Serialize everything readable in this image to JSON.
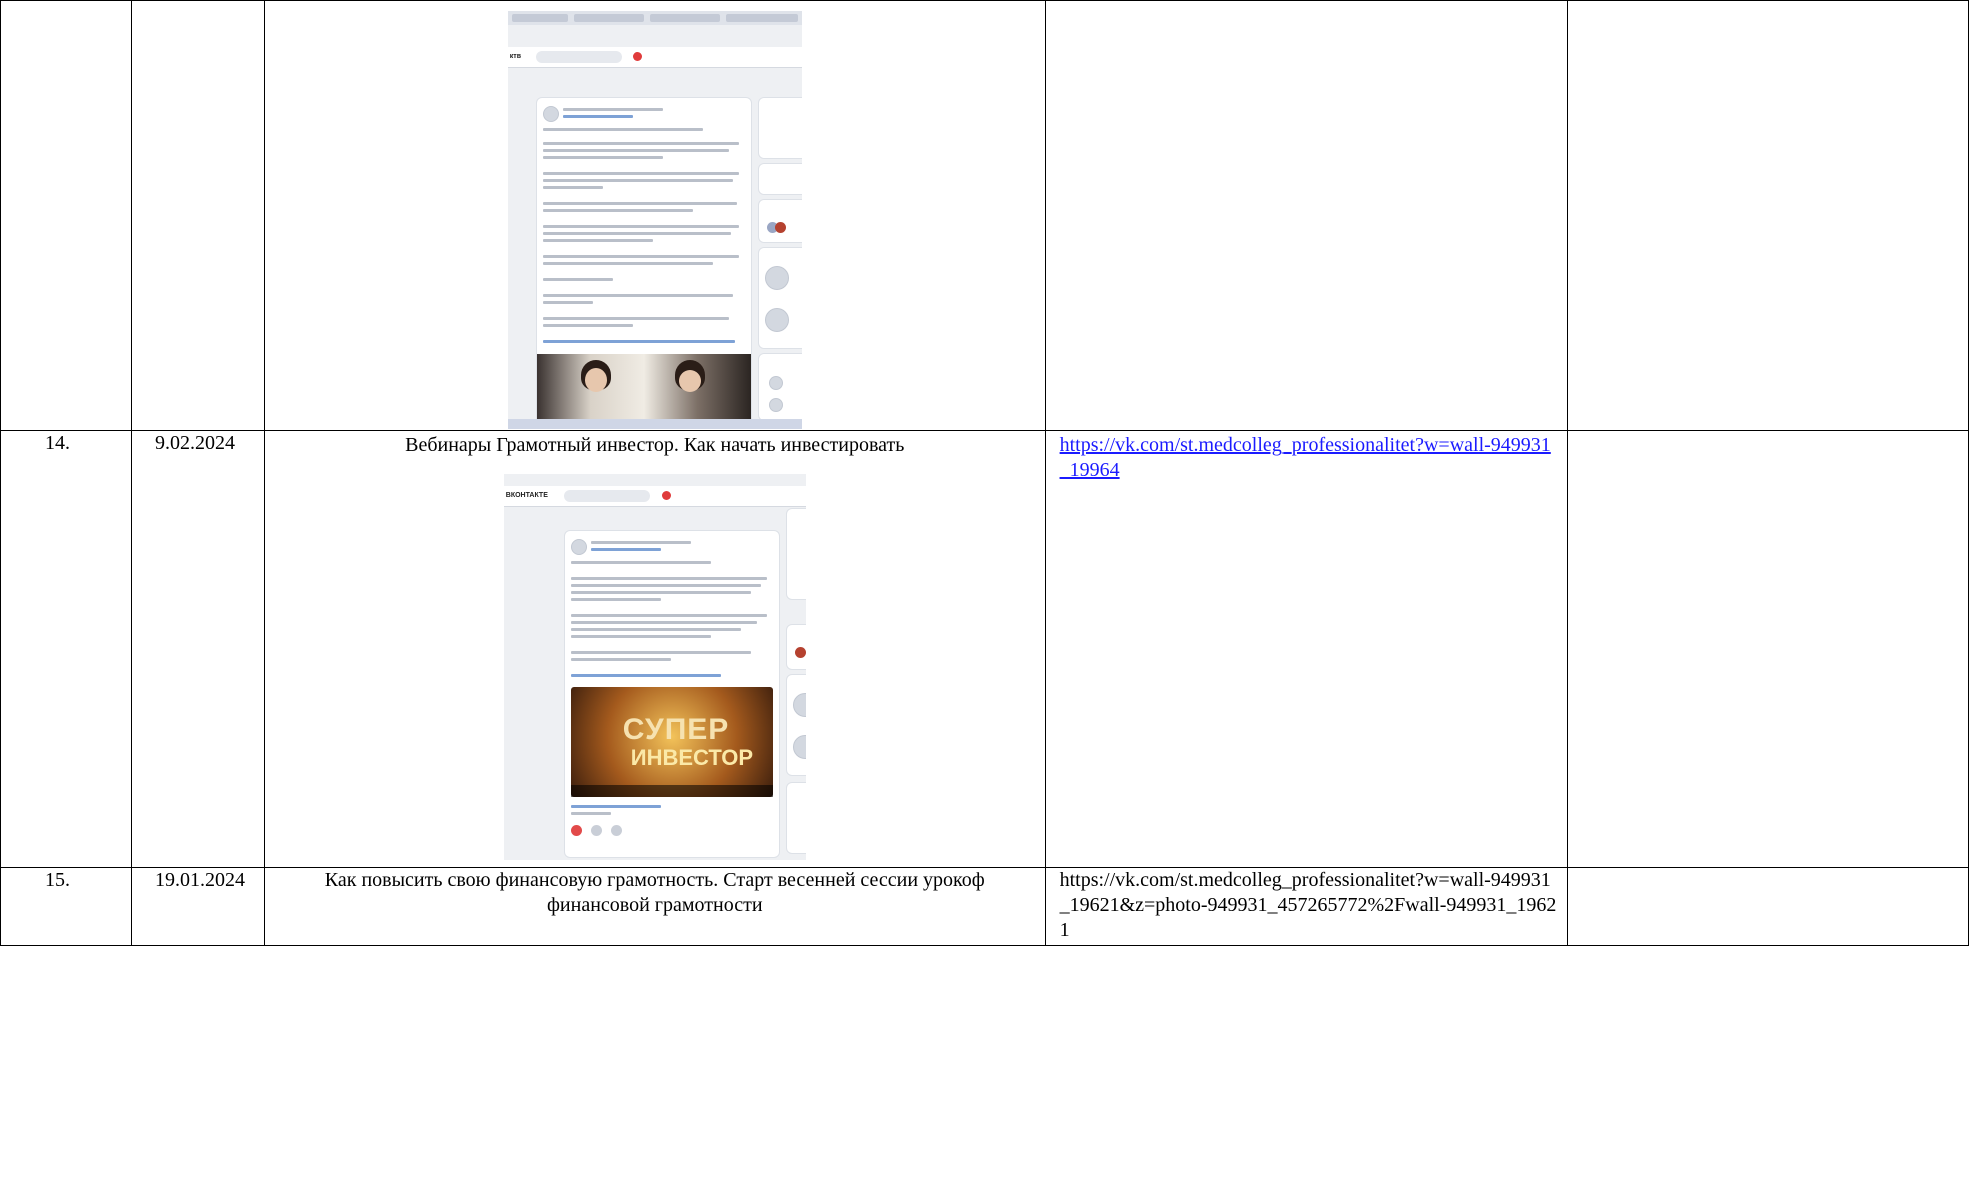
{
  "rows": [
    {
      "num": "",
      "date": "",
      "title": "",
      "link": "",
      "screenshot": "vk-post-screenshot-financial-literacy"
    },
    {
      "num": "14.",
      "date": "9.02.2024",
      "title": "Вебинары Грамотный инвестор. Как начать инвестировать",
      "link": "https://vk.com/st.medcolleg_professionalitet?w=wall-949931_19964",
      "screenshot": "vk-post-screenshot-investor-webinar"
    },
    {
      "num": "15.",
      "date": "19.01.2024",
      "title": "Как повысить свою финансовую грамотность. Старт весенней сессии урокоф финансовой грамотности",
      "link": "https://vk.com/st.medcolleg_professionalitet?w=wall-949931_19621&z=photo-949931_457265772%2Fwall-949931_19621"
    }
  ],
  "colors": {
    "border": "#000000",
    "link": "#1b1bff"
  }
}
